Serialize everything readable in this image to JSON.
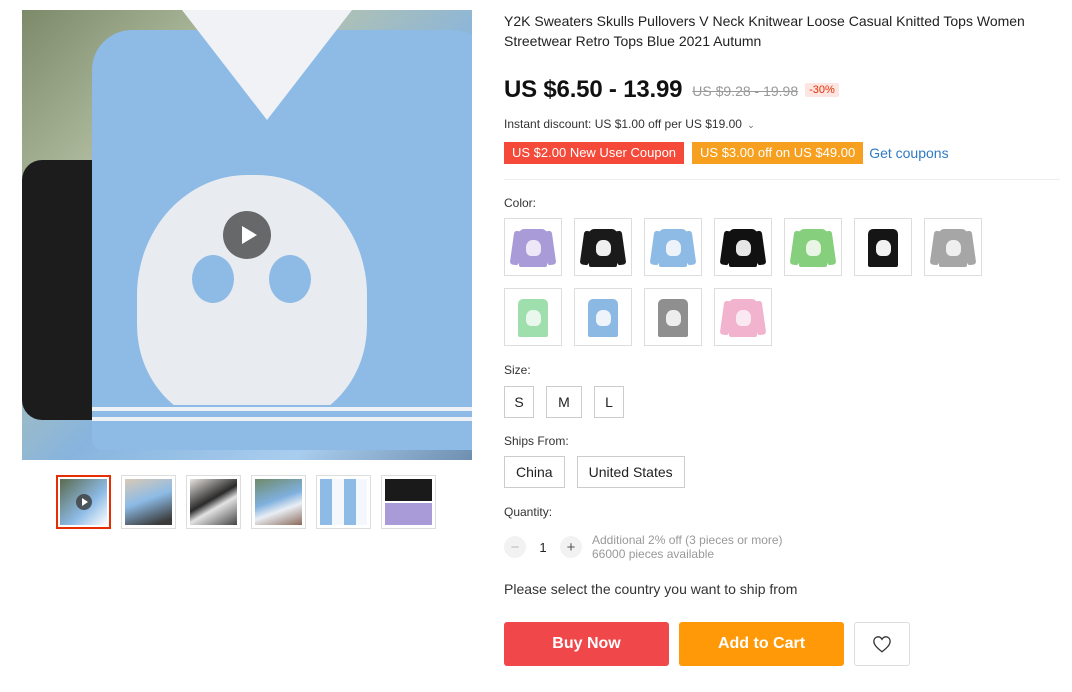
{
  "gallery": {
    "main_image_alt": "",
    "thumbnails": [
      {
        "active": true,
        "has_video": true
      },
      {
        "active": false,
        "has_video": false
      },
      {
        "active": false,
        "has_video": false
      },
      {
        "active": false,
        "has_video": false
      },
      {
        "active": false,
        "has_video": false
      },
      {
        "active": false,
        "has_video": false
      }
    ]
  },
  "product": {
    "title": "Y2K Sweaters Skulls Pullovers V Neck Knitwear Loose Casual Knitted Tops Women Streetwear Retro Tops Blue 2021 Autumn",
    "price": "US $6.50 - 13.99",
    "original_price": "US $9.28 - 19.98",
    "discount": "-30%",
    "instant_discount": "Instant discount: US $1.00 off per US $19.00",
    "coupons": [
      {
        "label": "US $2.00 New User Coupon"
      },
      {
        "label": "US $3.00 off on US $49.00"
      }
    ],
    "get_coupons": "Get coupons"
  },
  "color": {
    "label": "Color:",
    "options": [
      {
        "name": "purple",
        "color": "#a99ad8",
        "face": "#ece8f7",
        "vest": false
      },
      {
        "name": "black",
        "color": "#1a1a1a",
        "face": "#f0f0f0",
        "vest": false
      },
      {
        "name": "blue",
        "color": "#8dbbe6",
        "face": "#eef3f9",
        "vest": false
      },
      {
        "name": "black-skull",
        "color": "#111111",
        "face": "#e6e6e6",
        "vest": false
      },
      {
        "name": "green",
        "color": "#86cf7c",
        "face": "#e9f6e6",
        "vest": false
      },
      {
        "name": "black-vest",
        "color": "#151515",
        "face": "#f2f2f2",
        "vest": true
      },
      {
        "name": "grey",
        "color": "#a6a6a6",
        "face": "#efefef",
        "vest": false
      },
      {
        "name": "green-vest",
        "color": "#9fdfae",
        "face": "#eaf7ec",
        "vest": true
      },
      {
        "name": "blue-vest",
        "color": "#8cb8e4",
        "face": "#eef4fa",
        "vest": true
      },
      {
        "name": "grey-vest",
        "color": "#8f8f8f",
        "face": "#ededed",
        "vest": true
      },
      {
        "name": "pink",
        "color": "#f2b3cf",
        "face": "#fbe9f1",
        "vest": false
      }
    ]
  },
  "size": {
    "label": "Size:",
    "options": [
      "S",
      "M",
      "L"
    ]
  },
  "ships_from": {
    "label": "Ships From:",
    "options": [
      "China",
      "United States"
    ]
  },
  "quantity": {
    "label": "Quantity:",
    "value": "1",
    "minus": "−",
    "plus": "+",
    "note": "Additional 2% off (3 pieces or more)",
    "available": "66000 pieces available"
  },
  "ship_note": "Please select the country you want to ship from",
  "actions": {
    "buy_now": "Buy Now",
    "add_to_cart": "Add to Cart",
    "wishlist_icon": "heart-icon"
  },
  "colors": {
    "accent_red": "#f0474a",
    "accent_orange": "#ff9908",
    "link_blue": "#2f7ac4"
  }
}
